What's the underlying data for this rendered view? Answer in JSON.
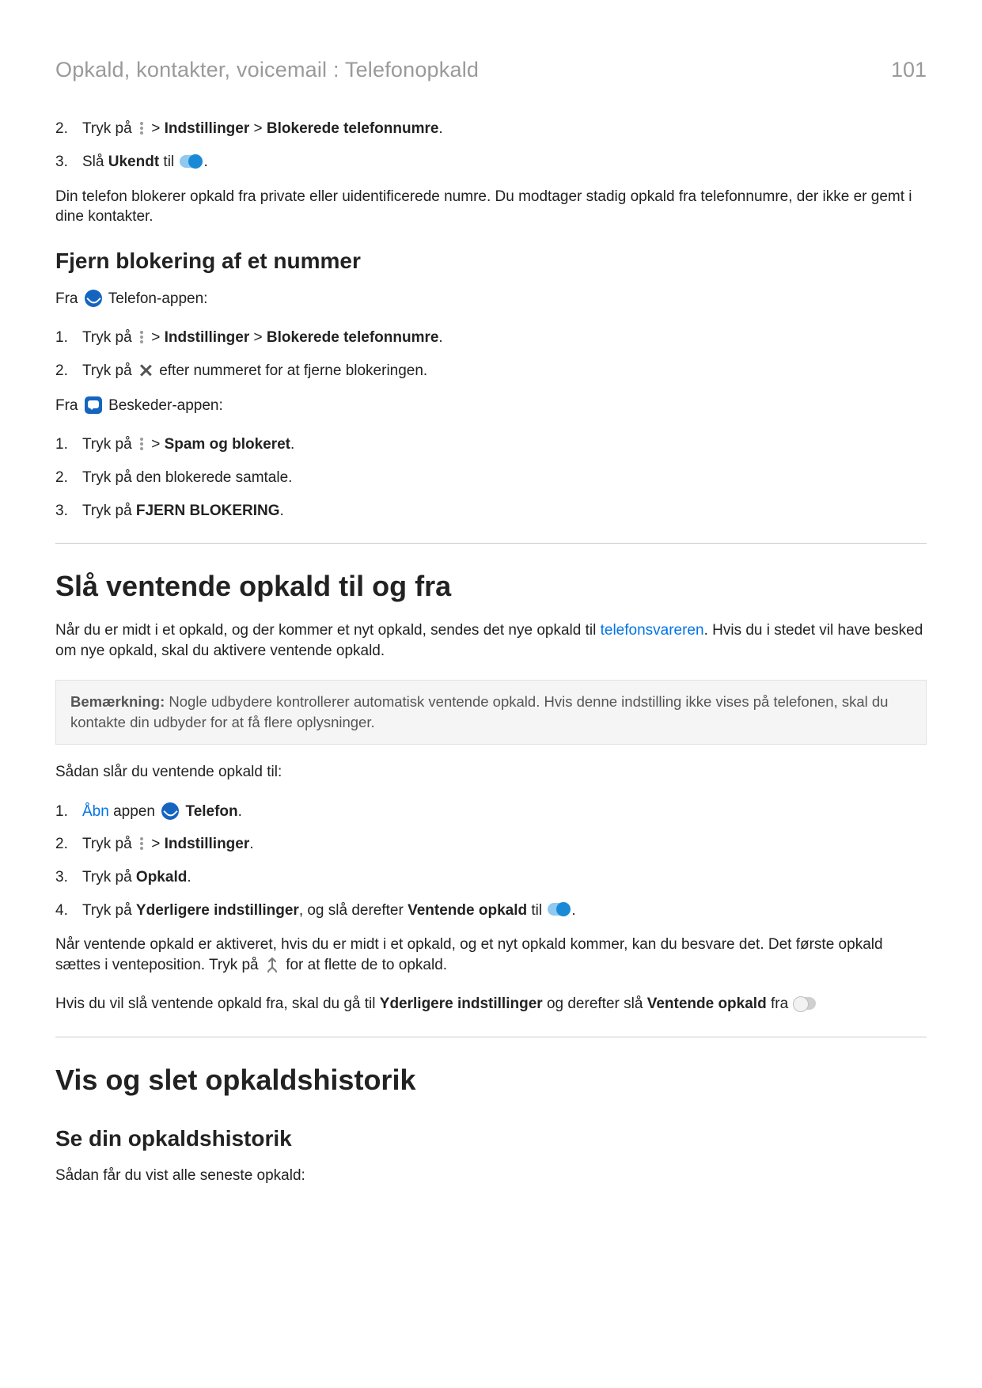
{
  "header": {
    "title": "Opkald, kontakter, voicemail : Telefonopkald",
    "page_num": "101"
  },
  "sec0": {
    "list": [
      {
        "n": "2.",
        "pre": "Tryk på ",
        "gt1": " > ",
        "b1": "Indstillinger",
        "gt2": " > ",
        "b2": "Blokerede telefonnumre",
        "post": "."
      },
      {
        "n": "3.",
        "pre": "Slå ",
        "b1": "Ukendt",
        "mid": " til ",
        "post": "."
      }
    ],
    "para": "Din telefon blokerer opkald fra private eller uidentificerede numre. Du modtager stadig opkald fra telefonnumre, der ikke er gemt i dine kontakter."
  },
  "sec1": {
    "title": "Fjern blokering af et nummer",
    "from_phone_pre": "Fra ",
    "from_phone_post": " Telefon-appen:",
    "listA": [
      {
        "n": "1.",
        "pre": "Tryk på ",
        "gt1": " > ",
        "b1": "Indstillinger",
        "gt2": " > ",
        "b2": "Blokerede telefonnumre",
        "post": "."
      },
      {
        "n": "2.",
        "pre": "Tryk på ",
        "post": " efter nummeret for at fjerne blokeringen."
      }
    ],
    "from_msg_pre": "Fra ",
    "from_msg_post": " Beskeder-appen:",
    "listB": [
      {
        "n": "1.",
        "pre": "Tryk på ",
        "gt1": " > ",
        "b1": "Spam og blokeret",
        "post": "."
      },
      {
        "n": "2.",
        "t": "Tryk på den blokerede samtale."
      },
      {
        "n": "3.",
        "pre": "Tryk på ",
        "b1": "FJERN BLOKERING",
        "post": "."
      }
    ]
  },
  "sec2": {
    "title": "Slå ventende opkald til og fra",
    "intro_pre": "Når du er midt i et opkald, og der kommer et nyt opkald, sendes det nye opkald til ",
    "intro_link": "telefonsvareren",
    "intro_post": ". Hvis du i stedet vil have besked om nye opkald, skal du aktivere ventende opkald.",
    "note_label": "Bemærkning:",
    "note_body": " Nogle udbydere kontrollerer automatisk ventende opkald. Hvis denne indstilling ikke vises på telefonen, skal du kontakte din udbyder for at få flere oplysninger.",
    "howto": "Sådan slår du ventende opkald til:",
    "list": [
      {
        "n": "1.",
        "link": "Åbn",
        "mid": " appen ",
        "b1": "Telefon",
        "post": "."
      },
      {
        "n": "2.",
        "pre": "Tryk på ",
        "gt1": " > ",
        "b1": "Indstillinger",
        "post": "."
      },
      {
        "n": "3.",
        "pre": "Tryk på ",
        "b1": "Opkald",
        "post": "."
      },
      {
        "n": "4.",
        "pre": "Tryk på ",
        "b1": "Yderligere indstillinger",
        "mid": ", og slå derefter ",
        "b2": "Ventende opkald",
        "mid2": " til ",
        "post": "."
      }
    ],
    "after1_pre": "Når ventende opkald er aktiveret, hvis du er midt i et opkald, og et nyt opkald kommer, kan du besvare det. Det første opkald sættes i venteposition. Tryk på ",
    "after1_post": " for at flette de to opkald.",
    "after2_pre": "Hvis du vil slå ventende opkald fra, skal du gå til ",
    "after2_b1": "Yderligere indstillinger",
    "after2_mid": " og derefter slå ",
    "after2_b2": "Ventende opkald",
    "after2_post": " fra "
  },
  "sec3": {
    "title": "Vis og slet opkaldshistorik",
    "sub": "Se din opkaldshistorik",
    "para": "Sådan får du vist alle seneste opkald:"
  }
}
